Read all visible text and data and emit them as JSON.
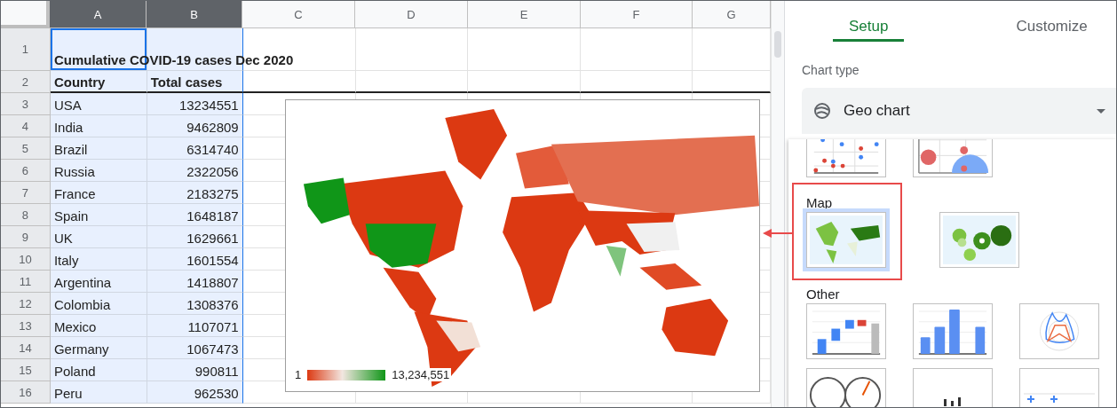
{
  "sheet": {
    "columns": [
      {
        "label": "A",
        "selected": true
      },
      {
        "label": "B",
        "selected": true
      },
      {
        "label": "C",
        "selected": false
      },
      {
        "label": "D",
        "selected": false
      },
      {
        "label": "E",
        "selected": false
      },
      {
        "label": "F",
        "selected": false
      },
      {
        "label": "G",
        "selected": false
      }
    ],
    "rows": [
      {
        "number": "1",
        "bold": true,
        "cells": [
          "Cumulative COVID-19 cases Dec 2020",
          ""
        ]
      },
      {
        "number": "2",
        "bold": true,
        "cells": [
          "Country",
          "Total cases"
        ]
      },
      {
        "number": "3",
        "bold": false,
        "cells": [
          "USA",
          "13234551"
        ]
      },
      {
        "number": "4",
        "bold": false,
        "cells": [
          "India",
          "9462809"
        ]
      },
      {
        "number": "5",
        "bold": false,
        "cells": [
          "Brazil",
          "6314740"
        ]
      },
      {
        "number": "6",
        "bold": false,
        "cells": [
          "Russia",
          "2322056"
        ]
      },
      {
        "number": "7",
        "bold": false,
        "cells": [
          "France",
          "2183275"
        ]
      },
      {
        "number": "8",
        "bold": false,
        "cells": [
          "Spain",
          "1648187"
        ]
      },
      {
        "number": "9",
        "bold": false,
        "cells": [
          "UK",
          "1629661"
        ]
      },
      {
        "number": "10",
        "bold": false,
        "cells": [
          "Italy",
          "1601554"
        ]
      },
      {
        "number": "11",
        "bold": false,
        "cells": [
          "Argentina",
          "1418807"
        ]
      },
      {
        "number": "12",
        "bold": false,
        "cells": [
          "Colombia",
          "1308376"
        ]
      },
      {
        "number": "13",
        "bold": false,
        "cells": [
          "Mexico",
          "1107071"
        ]
      },
      {
        "number": "14",
        "bold": false,
        "cells": [
          "Germany",
          "1067473"
        ]
      },
      {
        "number": "15",
        "bold": false,
        "cells": [
          "Poland",
          "990811"
        ]
      },
      {
        "number": "16",
        "bold": false,
        "cells": [
          "Peru",
          "962530"
        ]
      }
    ]
  },
  "chart": {
    "kind": "picture",
    "legend": {
      "min": "1",
      "max": "13,234,551"
    }
  },
  "editor": {
    "tabs": [
      {
        "label": "Setup",
        "selected": true
      },
      {
        "label": "Customize",
        "selected": false
      }
    ],
    "chart_type_label": "Chart type",
    "chart_type": "Geo chart",
    "sections": [
      {
        "options": [
          {
            "kind": "scatter",
            "selected": false
          },
          {
            "kind": "bubble",
            "selected": false
          }
        ]
      },
      {
        "title": "Map",
        "highlighted": true,
        "options": [
          {
            "kind": "geo",
            "selected": true
          },
          {
            "kind": "geo-bubble",
            "selected": false
          }
        ]
      },
      {
        "title": "Other",
        "options": [
          {
            "kind": "waterfall",
            "selected": false
          },
          {
            "kind": "histogram",
            "selected": false
          },
          {
            "kind": "radar",
            "selected": false
          },
          {
            "kind": "gauge",
            "selected": false
          },
          {
            "kind": "scorecard",
            "selected": false
          },
          {
            "kind": "timeline",
            "selected": false
          }
        ]
      }
    ]
  }
}
